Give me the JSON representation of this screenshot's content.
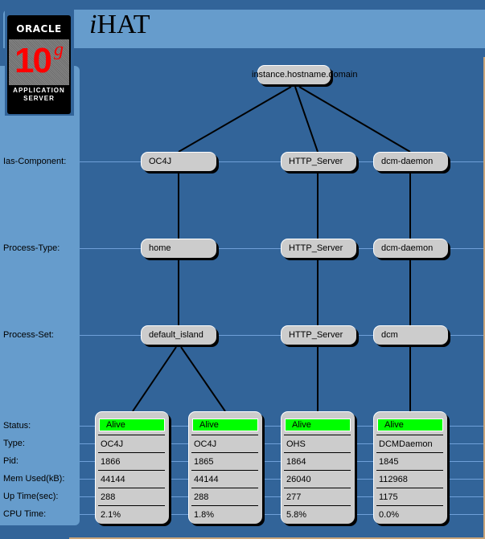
{
  "header": {
    "app_title_prefix": "i",
    "app_title_main": "HAT",
    "logo": {
      "brand": "ORACLE",
      "version_number": "10",
      "version_suffix": "g",
      "product_line1": "APPLICATION",
      "product_line2": "SERVER"
    }
  },
  "colors": {
    "background": "#326499",
    "panel": "#669ccc",
    "node": "#cccccc",
    "alive": "#00ff00"
  },
  "row_labels": {
    "ias_component": "Ias-Component:",
    "process_type": "Process-Type:",
    "process_set": "Process-Set:",
    "status": "Status:",
    "type": "Type:",
    "pid": "Pid:",
    "mem_used": "Mem Used(kB):",
    "up_time": "Up Time(sec):",
    "cpu_time": "CPU Time:"
  },
  "tree": {
    "root": "instance.hostname.domain",
    "ias_components": [
      "OC4J",
      "HTTP_Server",
      "dcm-daemon"
    ],
    "process_types": [
      "home",
      "HTTP_Server",
      "dcm-daemon"
    ],
    "process_sets": [
      "default_island",
      "HTTP_Server",
      "dcm"
    ]
  },
  "processes": [
    {
      "status": "Alive",
      "type": "OC4J",
      "pid": "1866",
      "mem_used": "44144",
      "up_time": "288",
      "cpu_time": "2.1%"
    },
    {
      "status": "Alive",
      "type": "OC4J",
      "pid": "1865",
      "mem_used": "44144",
      "up_time": "288",
      "cpu_time": "1.8%"
    },
    {
      "status": "Alive",
      "type": "OHS",
      "pid": "1864",
      "mem_used": "26040",
      "up_time": "277",
      "cpu_time": "5.8%"
    },
    {
      "status": "Alive",
      "type": "DCMDaemon",
      "pid": "1845",
      "mem_used": "112968",
      "up_time": "1175",
      "cpu_time": "0.0%"
    }
  ]
}
